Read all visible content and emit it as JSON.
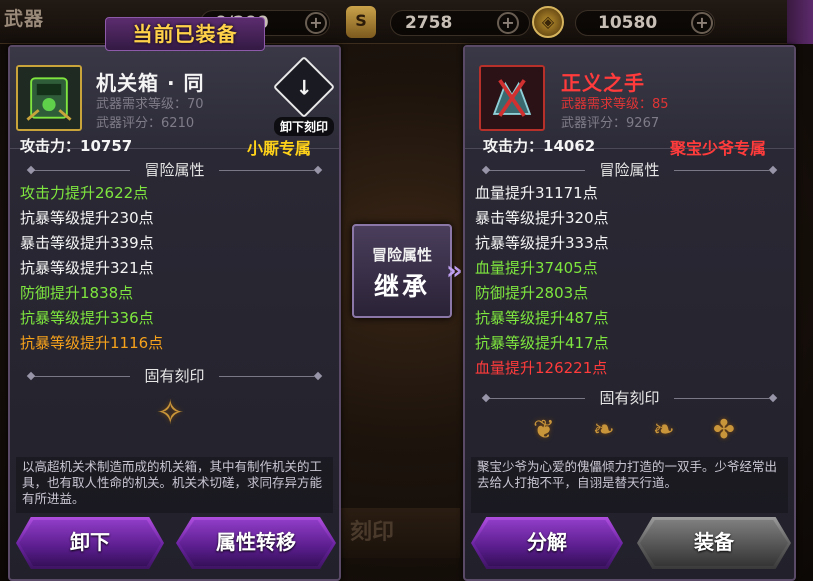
{
  "topbar": {
    "title": "武器",
    "currency1_value": "0/200",
    "currency2_value": "2758",
    "currency3_value": "10580",
    "plus_label": "+",
    "currency2_icon_glyph": "S",
    "currency3_icon_glyph": "◈"
  },
  "center": {
    "inherit_line1": "冒险属性",
    "inherit_line2": "继承",
    "background_engrave": "刻印"
  },
  "left": {
    "equipped_tag": "当前已装备",
    "name": "机关箱 · 同",
    "req_level_label": "武器需求等级",
    "req_level": "70",
    "score_label": "武器评分",
    "score": "6210",
    "unequip_engrave": "卸下刻印",
    "attack_label": "攻击力",
    "attack_value": "10757",
    "exclusive": "小厮专属",
    "adventure_title": "冒险属性",
    "attrs": [
      {
        "text": "攻击力提升2622点",
        "color": "green"
      },
      {
        "text": "抗暴等级提升230点",
        "color": "white"
      },
      {
        "text": "暴击等级提升339点",
        "color": "white"
      },
      {
        "text": "抗暴等级提升321点",
        "color": "white"
      },
      {
        "text": "防御提升1838点",
        "color": "green"
      },
      {
        "text": "抗暴等级提升336点",
        "color": "green"
      },
      {
        "text": "抗暴等级提升1116点",
        "color": "orange"
      }
    ],
    "inherent_title": "固有刻印",
    "description": "以高超机关术制造而成的机关箱，其中有制作机关的工具，也有取人性命的机关。机关术切磋，求同存异方能有所进益。",
    "btn_unequip": "卸下",
    "btn_transfer": "属性转移"
  },
  "right": {
    "name": "正义之手",
    "req_level_label": "武器需求等级",
    "req_level": "85",
    "score_label": "武器评分",
    "score": "9267",
    "attack_label": "攻击力",
    "attack_value": "14062",
    "exclusive": "聚宝少爷专属",
    "adventure_title": "冒险属性",
    "attrs": [
      {
        "text": "血量提升31171点",
        "color": "white"
      },
      {
        "text": "暴击等级提升320点",
        "color": "white"
      },
      {
        "text": "抗暴等级提升333点",
        "color": "white"
      },
      {
        "text": "血量提升37405点",
        "color": "green"
      },
      {
        "text": "防御提升2803点",
        "color": "green"
      },
      {
        "text": "抗暴等级提升487点",
        "color": "green"
      },
      {
        "text": "抗暴等级提升417点",
        "color": "green"
      },
      {
        "text": "血量提升126221点",
        "color": "red"
      }
    ],
    "inherent_title": "固有刻印",
    "description": "聚宝少爷为心爱的傀儡倾力打造的一双手。少爷经常出去给人打抱不平，自诩是替天行道。",
    "btn_decompose": "分解",
    "btn_equip": "装备"
  },
  "colors": {
    "green": "#7ee63e",
    "white": "#f4f4f4",
    "orange": "#f7a21b",
    "red": "#ff3b3b",
    "gold": "#ffd21a",
    "purple_button": "#7a2fb0",
    "gray_button": "#5e5e5e"
  }
}
